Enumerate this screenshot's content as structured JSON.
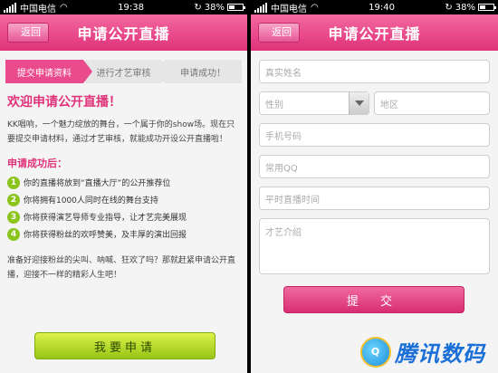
{
  "left": {
    "status": {
      "carrier": "中国电信",
      "time": "19:38",
      "battery": "38%"
    },
    "nav": {
      "back": "返回",
      "title": "申请公开直播"
    },
    "steps": [
      "提交申请资料",
      "进行才艺审核",
      "申请成功！"
    ],
    "welcome": "欢迎申请公开直播！",
    "intro": "KK唱响，一个魅力绽放的舞台，一个属于你的show场。现在只要提交申请材料，通过才艺审核，就能成功开设公开直播啦！",
    "success_title": "申请成功后：",
    "benefits": [
      {
        "num": "1",
        "text": "你的直播将放到“直播大厅”的公开推荐位"
      },
      {
        "num": "2",
        "text": "你将拥有1000人同时在线的舞台支持"
      },
      {
        "num": "3",
        "text": "你将获得演艺导师专业指导，让才艺完美展现"
      },
      {
        "num": "4",
        "text": "你将获得粉丝的欢呼赞美，及丰厚的演出回报"
      }
    ],
    "closing": "准备好迎接粉丝的尖叫、呐喊、狂欢了吗？那就赶紧申请公开直播，迎接不一样的精彩人生吧！",
    "apply_button": "我要申请"
  },
  "right": {
    "status": {
      "carrier": "中国电信",
      "time": "19:40",
      "battery": "38%"
    },
    "nav": {
      "back": "返回",
      "title": "申请公开直播"
    },
    "form": {
      "name_placeholder": "真实姓名",
      "gender_placeholder": "性别",
      "region_placeholder": "地区",
      "phone_placeholder": "手机号码",
      "qq_placeholder": "常用QQ",
      "time_placeholder": "平时直播时间",
      "talent_placeholder": "才艺介绍",
      "submit": "提 交"
    }
  },
  "watermark": {
    "text": "腾讯数码",
    "logo_text": "Q"
  }
}
